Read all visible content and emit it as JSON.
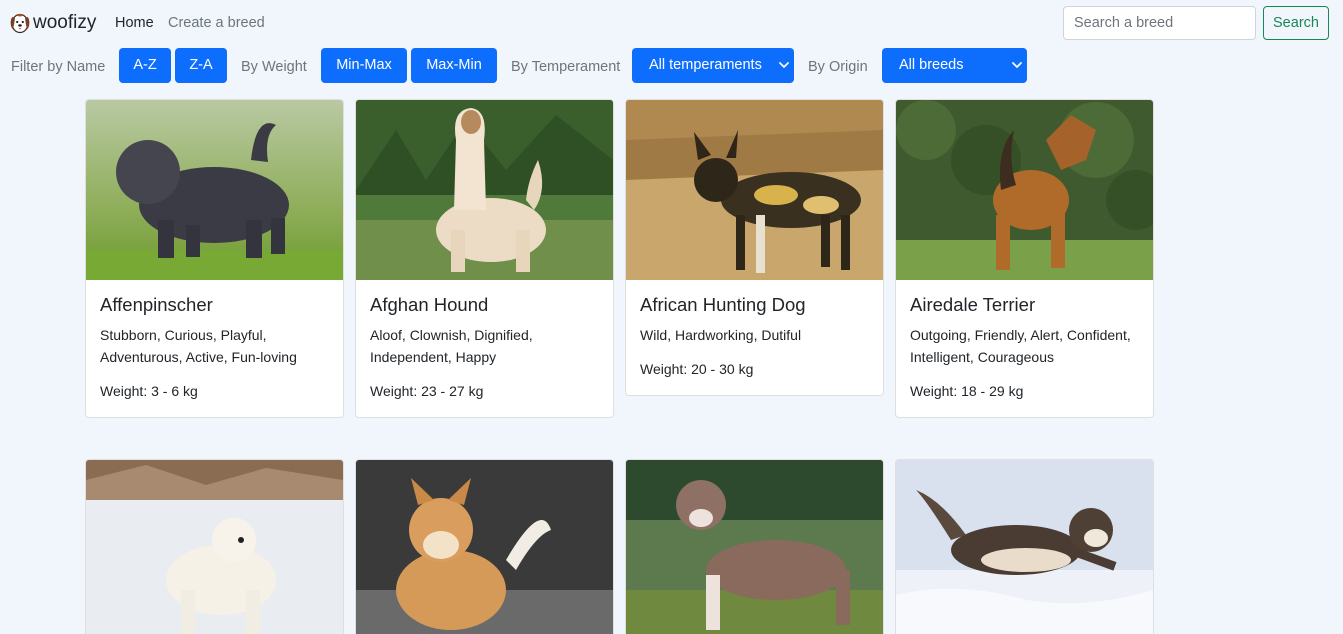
{
  "brand": {
    "name": "woofizy",
    "logo_icon": "dog-face-icon"
  },
  "nav": {
    "home": "Home",
    "create": "Create a breed"
  },
  "search": {
    "placeholder": "Search a breed",
    "button": "Search"
  },
  "filters": {
    "by_name_label": "Filter by Name",
    "az": "A-Z",
    "za": "Z-A",
    "by_weight_label": "By Weight",
    "min_max": "Min-Max",
    "max_min": "Max-Min",
    "by_temperament_label": "By Temperament",
    "temperament_selected": "All temperaments",
    "by_origin_label": "By Origin",
    "origin_selected": "All breeds"
  },
  "colors": {
    "primary": "#0d6efd",
    "success": "#198754",
    "page_bg": "#f1f6fd"
  },
  "breeds": [
    {
      "name": "Affenpinscher",
      "temperament": "Stubborn, Curious, Playful, Adventurous, Active, Fun-loving",
      "weight": "Weight: 3 - 6 kg",
      "photo": "black-terrier-on-grass-photo"
    },
    {
      "name": "Afghan Hound",
      "temperament": "Aloof, Clownish, Dignified, Independent, Happy",
      "weight": "Weight: 23 - 27 kg",
      "photo": "afghan-hound-in-field-photo"
    },
    {
      "name": "African Hunting Dog",
      "temperament": "Wild, Hardworking, Dutiful",
      "weight": "Weight: 20 - 30 kg",
      "photo": "wild-dog-in-dry-grass-photo"
    },
    {
      "name": "Airedale Terrier",
      "temperament": "Outgoing, Friendly, Alert, Confident, Intelligent, Courageous",
      "weight": "Weight: 18 - 29 kg",
      "photo": "airedale-by-hedge-photo"
    },
    {
      "photo": "white-dog-in-snow-photo"
    },
    {
      "photo": "akita-on-pavement-photo"
    },
    {
      "photo": "pit-bull-on-grass-photo"
    },
    {
      "photo": "husky-running-in-snow-photo"
    }
  ]
}
